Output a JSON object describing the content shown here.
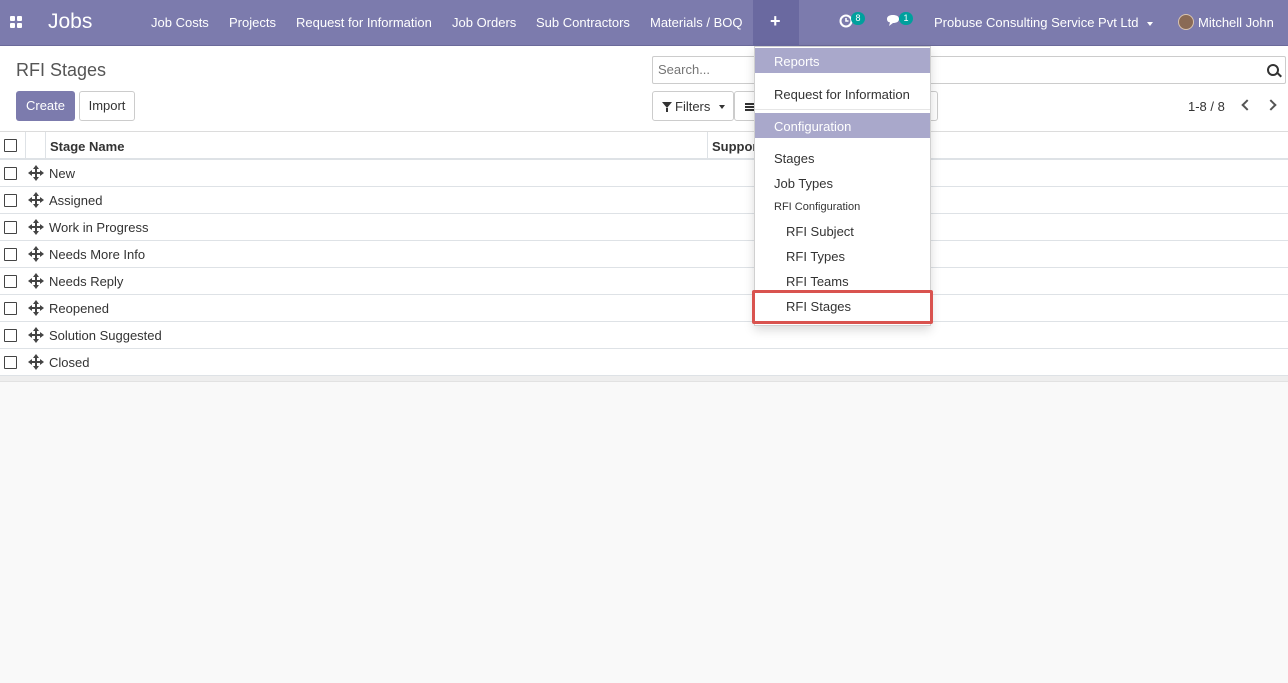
{
  "navbar": {
    "brand": "Jobs",
    "menus": [
      "Job Costs",
      "Projects",
      "Request for Information",
      "Job Orders",
      "Sub Contractors",
      "Materials / BOQ"
    ],
    "plus": "+",
    "activity_count": "8",
    "messages_count": "1",
    "company": "Probuse Consulting Service Pvt Ltd",
    "user": "Mitchell John"
  },
  "control": {
    "title": "RFI Stages",
    "create_label": "Create",
    "import_label": "Import",
    "search_placeholder": "Search...",
    "filters_label": "Filters",
    "pager": "1-8 / 8"
  },
  "table": {
    "columns": [
      "Stage Name",
      "Suppor"
    ],
    "rows": [
      "New",
      "Assigned",
      "Work in Progress",
      "Needs More Info",
      "Needs Reply",
      "Reopened",
      "Solution Suggested",
      "Closed"
    ]
  },
  "dropdown": {
    "reports_header": "Reports",
    "rfi_item": "Request for Information",
    "config_header": "Configuration",
    "stages": "Stages",
    "job_types": "Job Types",
    "rfi_config": "RFI Configuration",
    "rfi_subject": "RFI Subject",
    "rfi_types": "RFI Types",
    "rfi_teams": "RFI Teams",
    "rfi_stages": "RFI Stages"
  },
  "colors": {
    "navbar": "#7c7bad",
    "primary": "#7c7bad",
    "dropdown_header": "#a9a8cb",
    "badge": "#00a09d",
    "highlight": "#d9534f"
  }
}
